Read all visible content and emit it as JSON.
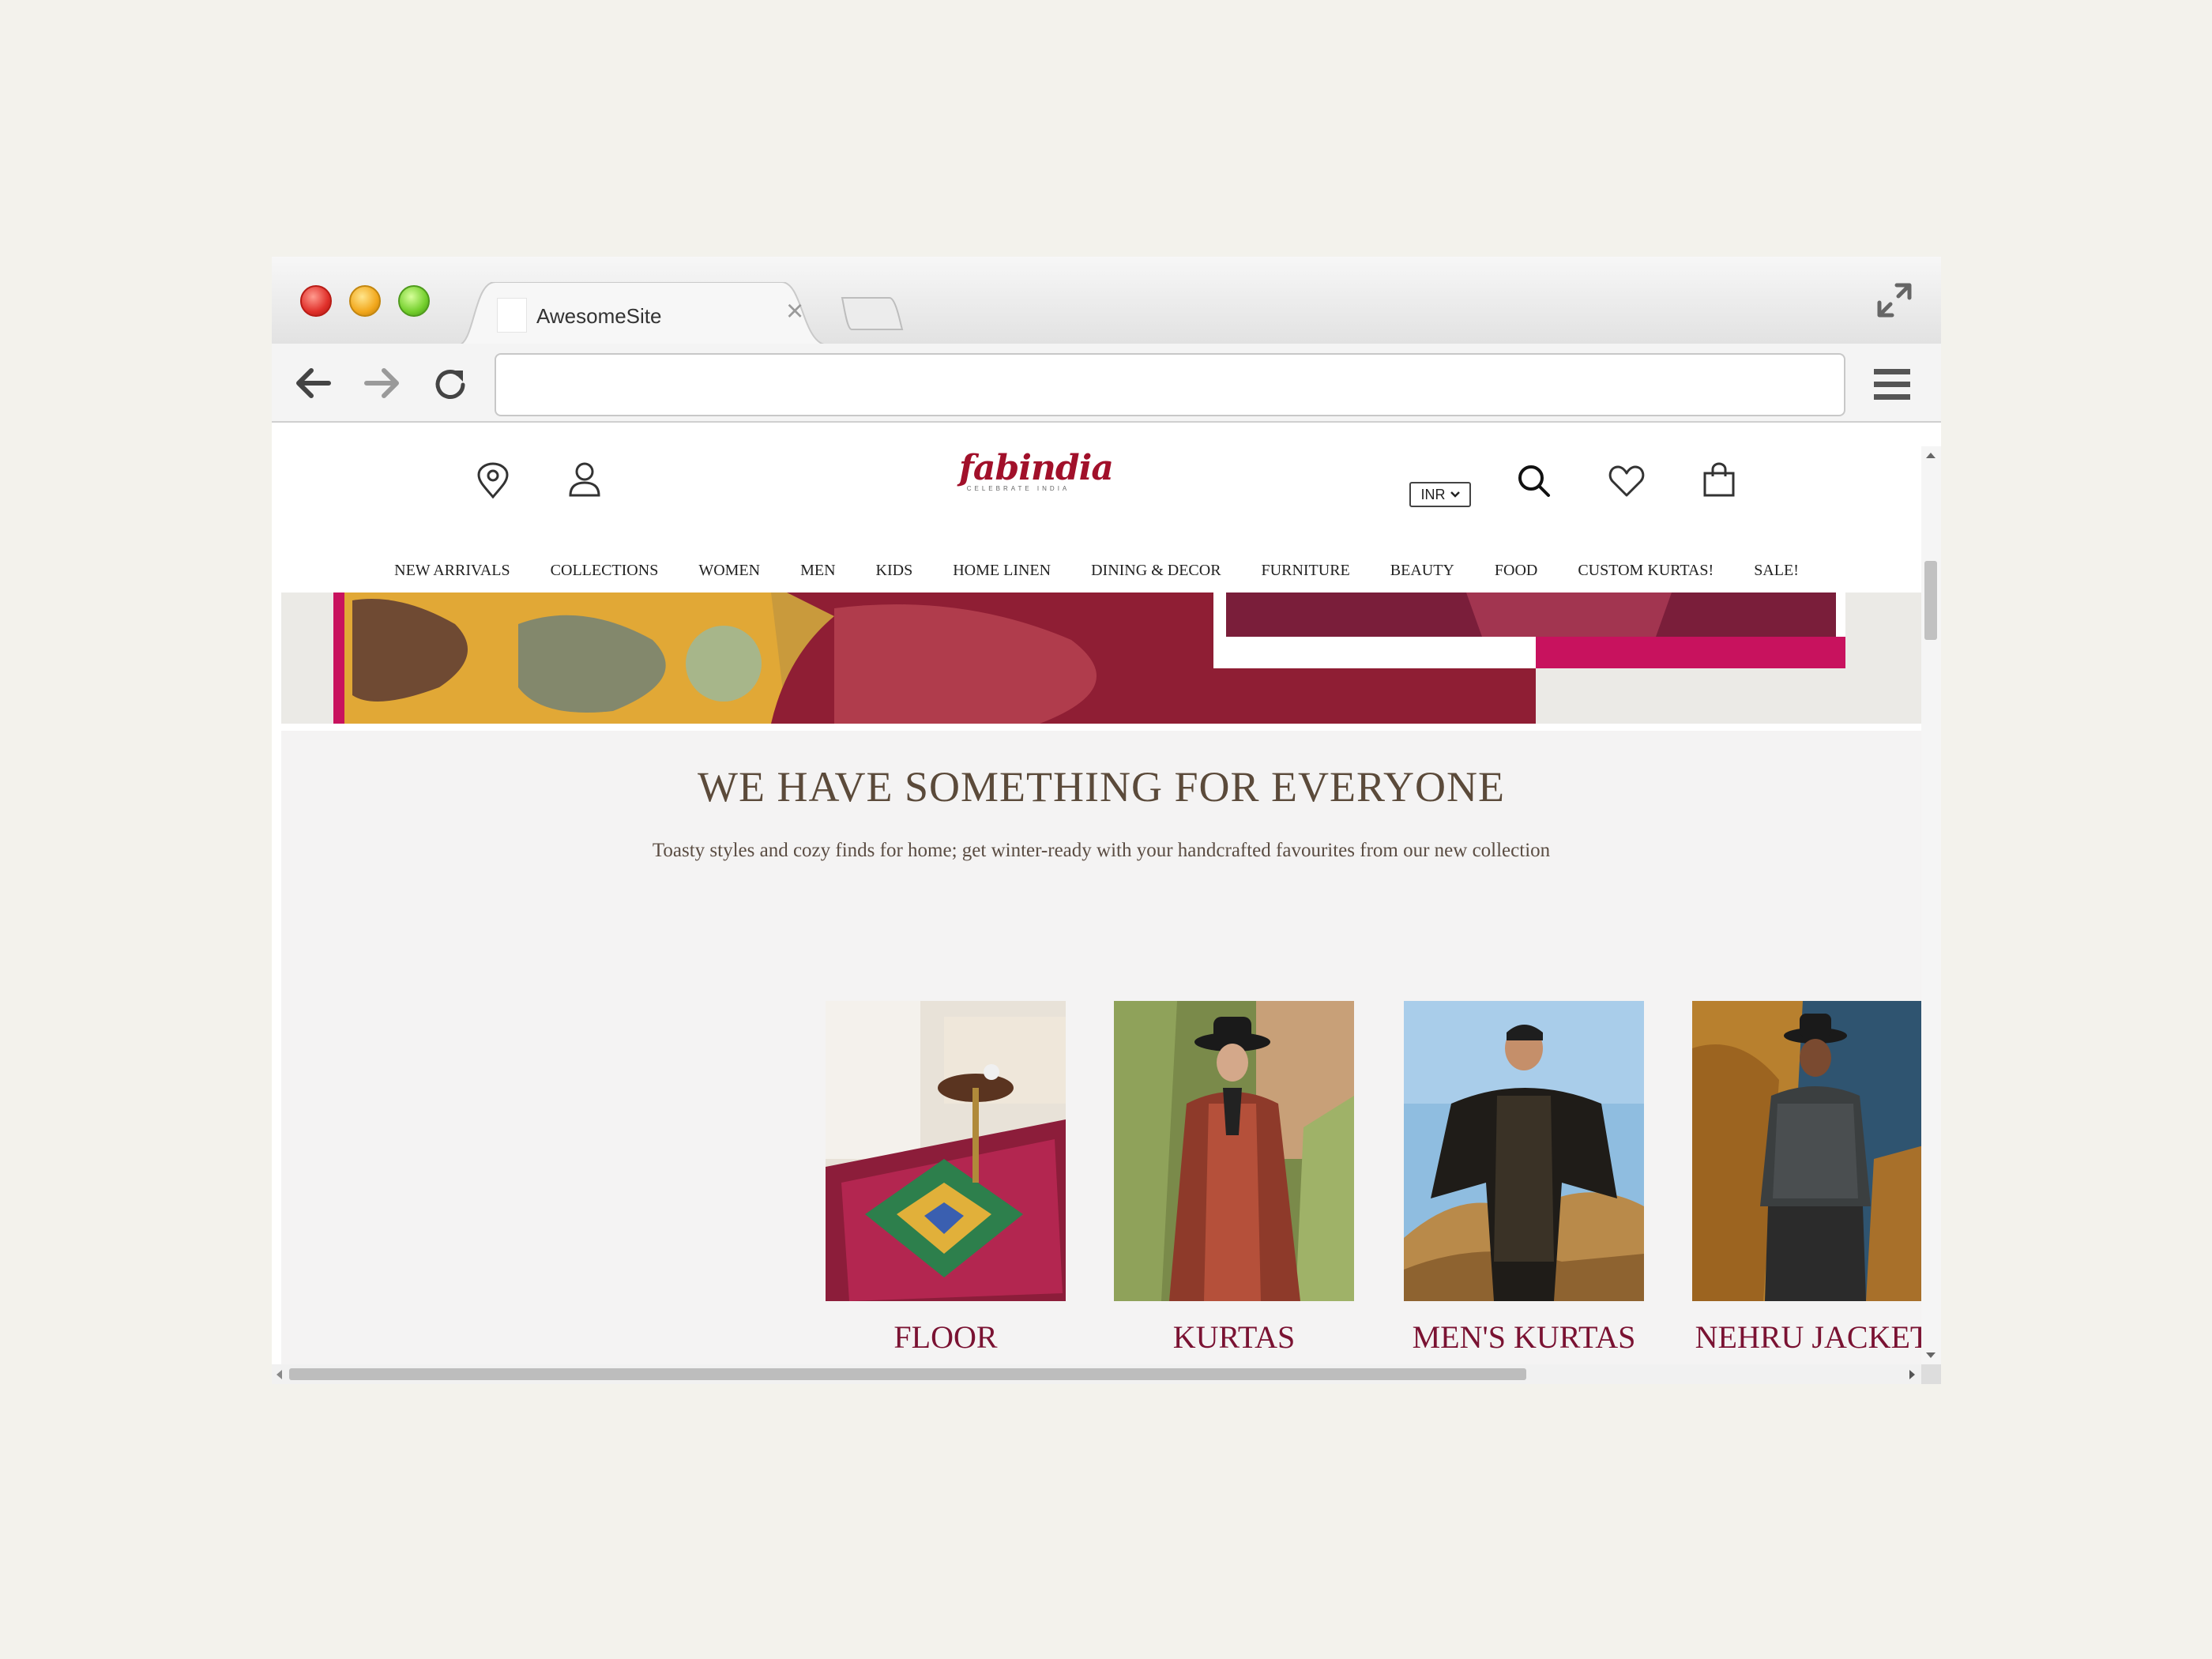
{
  "browser": {
    "tab_title": "AwesomeSite",
    "url": ""
  },
  "site": {
    "brand": "fabindia",
    "tagline": "CELEBRATE INDIA",
    "currency": "INR",
    "nav": [
      "NEW ARRIVALS",
      "COLLECTIONS",
      "WOMEN",
      "MEN",
      "KIDS",
      "HOME LINEN",
      "DINING & DECOR",
      "FURNITURE",
      "BEAUTY",
      "FOOD",
      "CUSTOM KURTAS!",
      "SALE!"
    ],
    "headline": "WE HAVE SOMETHING FOR EVERYONE",
    "subline": "Toasty styles and cozy finds for home; get winter-ready with your handcrafted favourites from our new collection",
    "categories": [
      {
        "label": "FLOOR"
      },
      {
        "label": "KURTAS"
      },
      {
        "label": "MEN'S KURTAS"
      },
      {
        "label": "NEHRU JACKET"
      }
    ]
  },
  "colors": {
    "brand": "#a1102a",
    "category_label": "#7a1232",
    "headline": "#5b4a3a"
  }
}
